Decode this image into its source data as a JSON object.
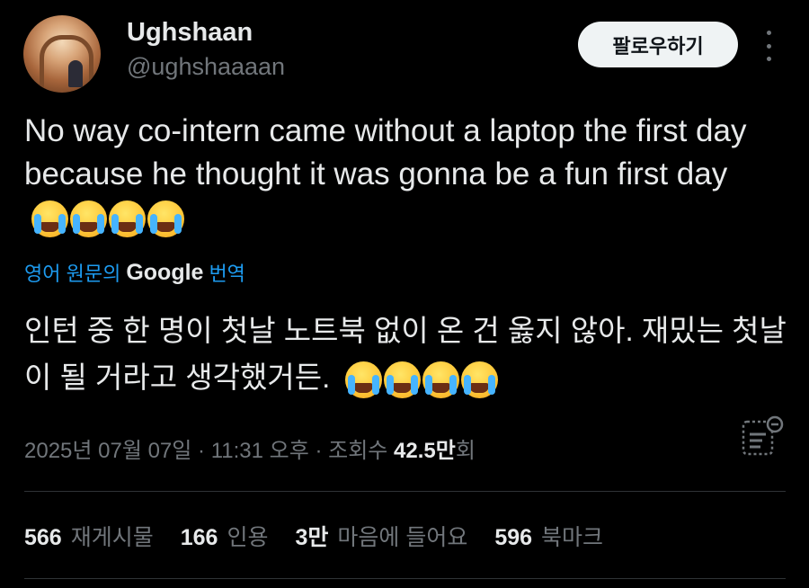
{
  "author": {
    "name": "Ughshaan",
    "handle": "@ughshaaaan"
  },
  "header": {
    "follow_label": "팔로우하기",
    "more_icon": "more-vertical-icon"
  },
  "tweet": {
    "text": "No way co-intern came without a laptop the first day because he thought it was gonna be a fun first day",
    "emoji": [
      "loudly-crying-face",
      "loudly-crying-face",
      "loudly-crying-face",
      "loudly-crying-face"
    ]
  },
  "translation": {
    "prefix": "영어 원문의",
    "brand": "Google",
    "suffix": "번역",
    "text": "인턴 중 한 명이 첫날 노트북 없이 온 건 옳지 않아. 재밌는 첫날이 될 거라고 생각했거든."
  },
  "meta": {
    "date": "2025년 07월 07일",
    "sep1": " · ",
    "time": "11:31 오후",
    "sep2": " · ",
    "views_label": "조회수 ",
    "views_value": "42.5만",
    "views_suffix": "회",
    "stats_icon": "view-stats-icon"
  },
  "stats": {
    "reposts_value": "566",
    "reposts_label": "재게시물",
    "quotes_value": "166",
    "quotes_label": "인용",
    "likes_value": "3만",
    "likes_label": "마음에 들어요",
    "bookmarks_value": "596",
    "bookmarks_label": "북마크"
  },
  "colors": {
    "background": "#000000",
    "text": "#e7e9ea",
    "muted": "#71767b",
    "link": "#1d9bf0",
    "divider": "#2f3336"
  }
}
